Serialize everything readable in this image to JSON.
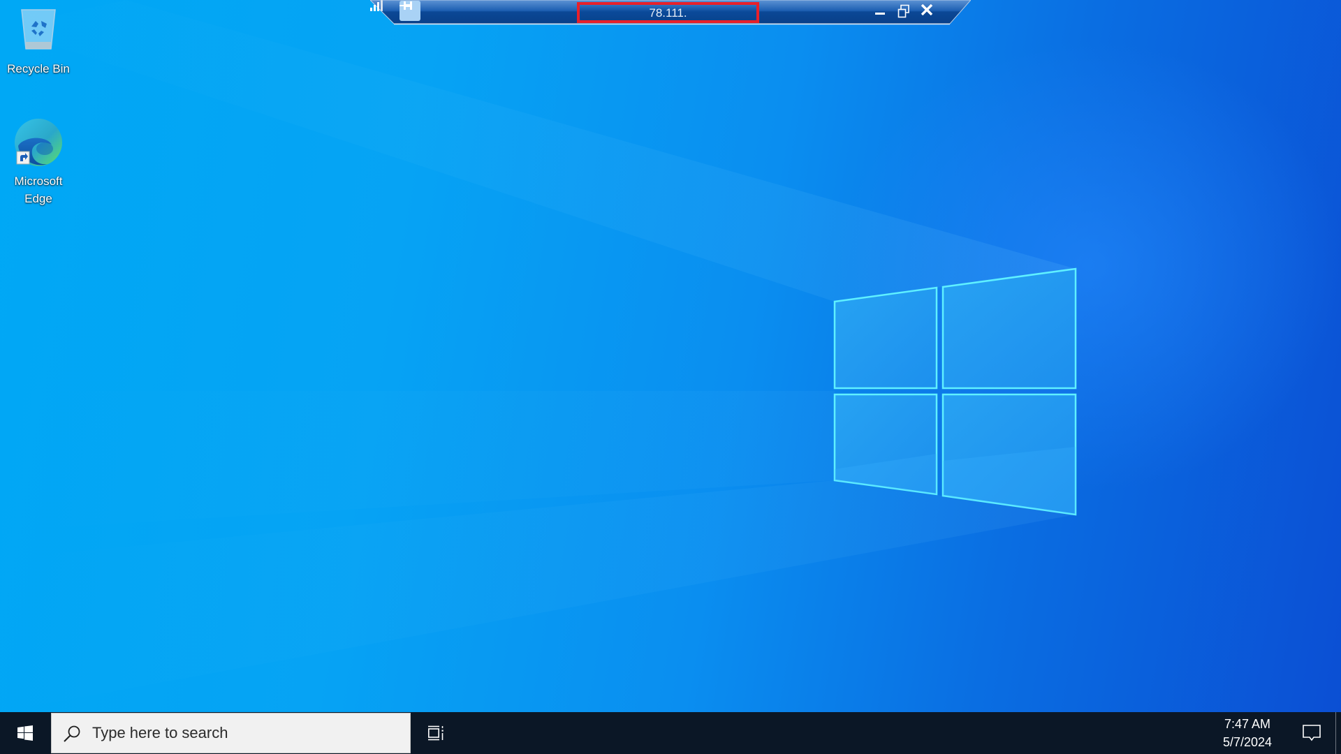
{
  "desktop": {
    "icons": [
      {
        "label": "Recycle Bin",
        "icon": "recycle-bin-icon"
      },
      {
        "label": "Microsoft\nEdge",
        "label_line1": "Microsoft",
        "label_line2": "Edge",
        "icon": "edge-icon"
      }
    ],
    "wallpaper": "Windows 10 default"
  },
  "remote_connection_bar": {
    "title": "78.111.",
    "pin_icon": "pin-icon",
    "signal_icon": "signal-strength-icon",
    "controls": {
      "minimize": "minimize-icon",
      "restore": "restore-icon",
      "close": "close-icon"
    },
    "highlight_color": "#e8202a"
  },
  "taskbar": {
    "start_icon": "windows-start-icon",
    "search": {
      "placeholder": "Type here to search",
      "value": ""
    },
    "task_view_icon": "task-view-icon",
    "clock": {
      "time": "7:47 AM",
      "date": "5/7/2024"
    },
    "notification_icon": "action-center-icon"
  }
}
